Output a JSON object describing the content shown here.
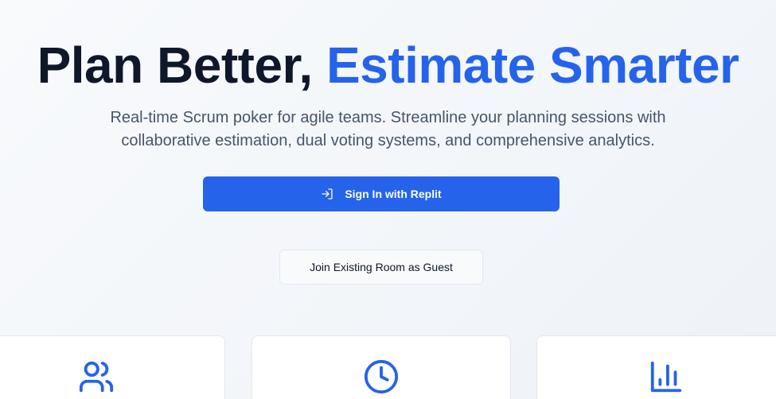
{
  "hero": {
    "title_plain": "Plan Better,",
    "title_accent": "Estimate Smarter",
    "subtitle": "Real-time Scrum poker for agile teams. Streamline your planning sessions with collaborative estimation, dual voting systems, and comprehensive analytics."
  },
  "actions": {
    "sign_in_label": "Sign In with Replit",
    "sign_in_icon": "log-in-icon",
    "guest_label": "Join Existing Room as Guest"
  },
  "features": [
    {
      "icon": "users-icon"
    },
    {
      "icon": "clock-icon"
    },
    {
      "icon": "bar-chart-icon"
    }
  ],
  "colors": {
    "accent": "#2563eb",
    "heading": "#0f172a",
    "muted": "#475569",
    "background": "#f1f5f9"
  }
}
